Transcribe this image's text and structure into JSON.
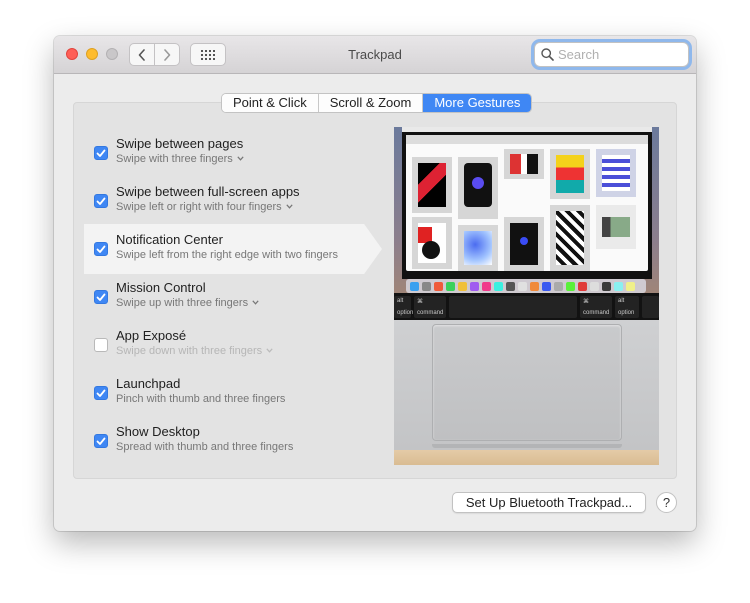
{
  "window": {
    "title": "Trackpad"
  },
  "search": {
    "placeholder": "Search",
    "value": ""
  },
  "tabs": [
    {
      "label": "Point & Click",
      "active": false
    },
    {
      "label": "Scroll & Zoom",
      "active": false
    },
    {
      "label": "More Gestures",
      "active": true
    }
  ],
  "gestures": [
    {
      "title": "Swipe between pages",
      "subtitle": "Swipe with three fingers",
      "checked": true,
      "has_dropdown": true
    },
    {
      "title": "Swipe between full-screen apps",
      "subtitle": "Swipe left or right with four fingers",
      "checked": true,
      "has_dropdown": true
    },
    {
      "title": "Notification Center",
      "subtitle": "Swipe left from the right edge with two fingers",
      "checked": true,
      "has_dropdown": false,
      "selected": true
    },
    {
      "title": "Mission Control",
      "subtitle": "Swipe up with three fingers",
      "checked": true,
      "has_dropdown": true
    },
    {
      "title": "App Exposé",
      "subtitle": "Swipe down with three fingers",
      "checked": false,
      "has_dropdown": true,
      "dimmed": true
    },
    {
      "title": "Launchpad",
      "subtitle": "Pinch with thumb and three fingers",
      "checked": true,
      "has_dropdown": false
    },
    {
      "title": "Show Desktop",
      "subtitle": "Spread with thumb and three fingers",
      "checked": true,
      "has_dropdown": false
    }
  ],
  "preview": {
    "keys": [
      {
        "top": "alt",
        "bottom": "option"
      },
      {
        "top": "⌘",
        "bottom": "command"
      },
      {
        "top": "⌘",
        "bottom": "command"
      },
      {
        "top": "alt",
        "bottom": "option"
      }
    ]
  },
  "footer": {
    "setup_button": "Set Up Bluetooth Trackpad...",
    "help_button": "?"
  },
  "colors": {
    "accent": "#3f87f4",
    "window_bg": "#ececec",
    "panel_bg": "#e3e3e3"
  }
}
